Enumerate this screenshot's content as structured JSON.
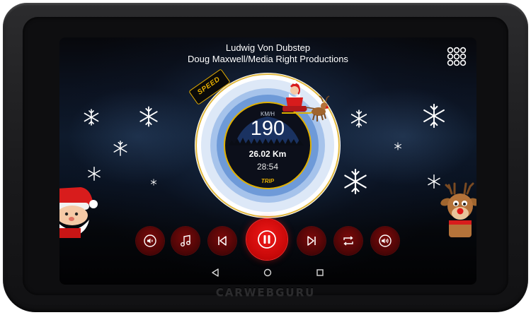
{
  "device": {
    "brand": "CARWEBGURU"
  },
  "track": {
    "title": "Ludwig Von Dubstep",
    "artist": "Doug Maxwell/Media Right Productions"
  },
  "gauge": {
    "badge": "SPEED",
    "unit": "KM/H",
    "speed": "190",
    "distance": "26.02 Km",
    "time": "28:54",
    "mode": "TRIP"
  },
  "controls": [
    "volume-down",
    "music-library",
    "previous",
    "pause",
    "next",
    "repeat",
    "volume-up"
  ],
  "nav": [
    "back",
    "home",
    "recents"
  ],
  "colors": {
    "accent": "#c60808",
    "gold": "#e8b000",
    "dial": "#1f3f7a"
  }
}
